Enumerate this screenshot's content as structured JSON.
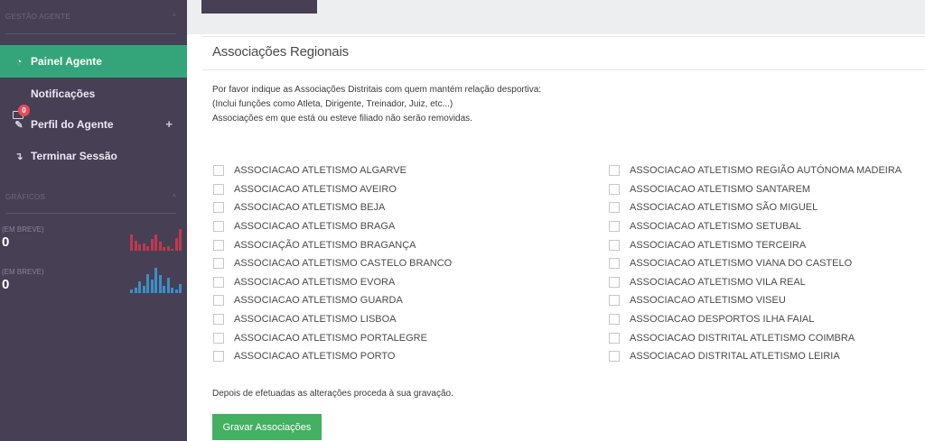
{
  "sidebar": {
    "section_agent": "GESTÃO AGENTE",
    "section_charts": "GRÁFICOS",
    "items": [
      {
        "label": "Painel Agente",
        "icon": "dashboard-icon"
      },
      {
        "label": "Notificações",
        "icon": "mail-icon",
        "badge": "0"
      },
      {
        "label": "Perfil do Agente",
        "icon": "pencil-icon",
        "extra": "+"
      },
      {
        "label": "Terminar Sessão",
        "icon": "logout-icon"
      }
    ],
    "stats": [
      {
        "label": "(EM BREVE)",
        "value": "0",
        "color": "#c0394b"
      },
      {
        "label": "(EM BREVE)",
        "value": "0",
        "color": "#3a8fc9"
      }
    ]
  },
  "panel": {
    "title": "Associações Regionais",
    "intro_line1": "Por favor indique as Associações Distritais com quem mantém relação desportiva:",
    "intro_line2": "(Inclui funções como Atleta, Dirigente, Treinador, Juiz, etc...)",
    "intro_line3": "Associações em que está ou esteve filiado não serão removidas.",
    "left_column": [
      "ASSOCIACAO ATLETISMO ALGARVE",
      "ASSOCIACAO ATLETISMO AVEIRO",
      "ASSOCIACAO ATLETISMO BEJA",
      "ASSOCIACAO ATLETISMO BRAGA",
      "ASSOCIAÇÃO ATLETISMO BRAGANÇA",
      "ASSOCIACAO ATLETISMO CASTELO BRANCO",
      "ASSOCIACAO ATLETISMO EVORA",
      "ASSOCIACAO ATLETISMO GUARDA",
      "ASSOCIACAO ATLETISMO LISBOA",
      "ASSOCIACAO ATLETISMO PORTALEGRE",
      "ASSOCIACAO ATLETISMO PORTO"
    ],
    "right_column": [
      "ASSOCIACAO ATLETISMO REGIÃO AUTÓNOMA MADEIRA",
      "ASSOCIACAO ATLETISMO SANTAREM",
      "ASSOCIACAO ATLETISMO SÃO MIGUEL",
      "ASSOCIACAO ATLETISMO SETUBAL",
      "ASSOCIACAO ATLETISMO TERCEIRA",
      "ASSOCIACAO ATLETISMO VIANA DO CASTELO",
      "ASSOCIACAO ATLETISMO VILA REAL",
      "ASSOCIACAO ATLETISMO VISEU",
      "ASSOCIACAO DESPORTOS ILHA FAIAL",
      "ASSOCIACAO DISTRITAL ATLETISMO COIMBRA",
      "ASSOCIACAO DISTRITAL ATLETISMO LEIRIA"
    ],
    "footer_note": "Depois de efetuadas as alterações proceda à sua gravação.",
    "save_label": "Gravar Associações"
  },
  "colors": {
    "sidebar_bg": "#473f54",
    "active_item": "#34a57a",
    "save_button": "#43b062",
    "badge": "#e74c5b"
  }
}
